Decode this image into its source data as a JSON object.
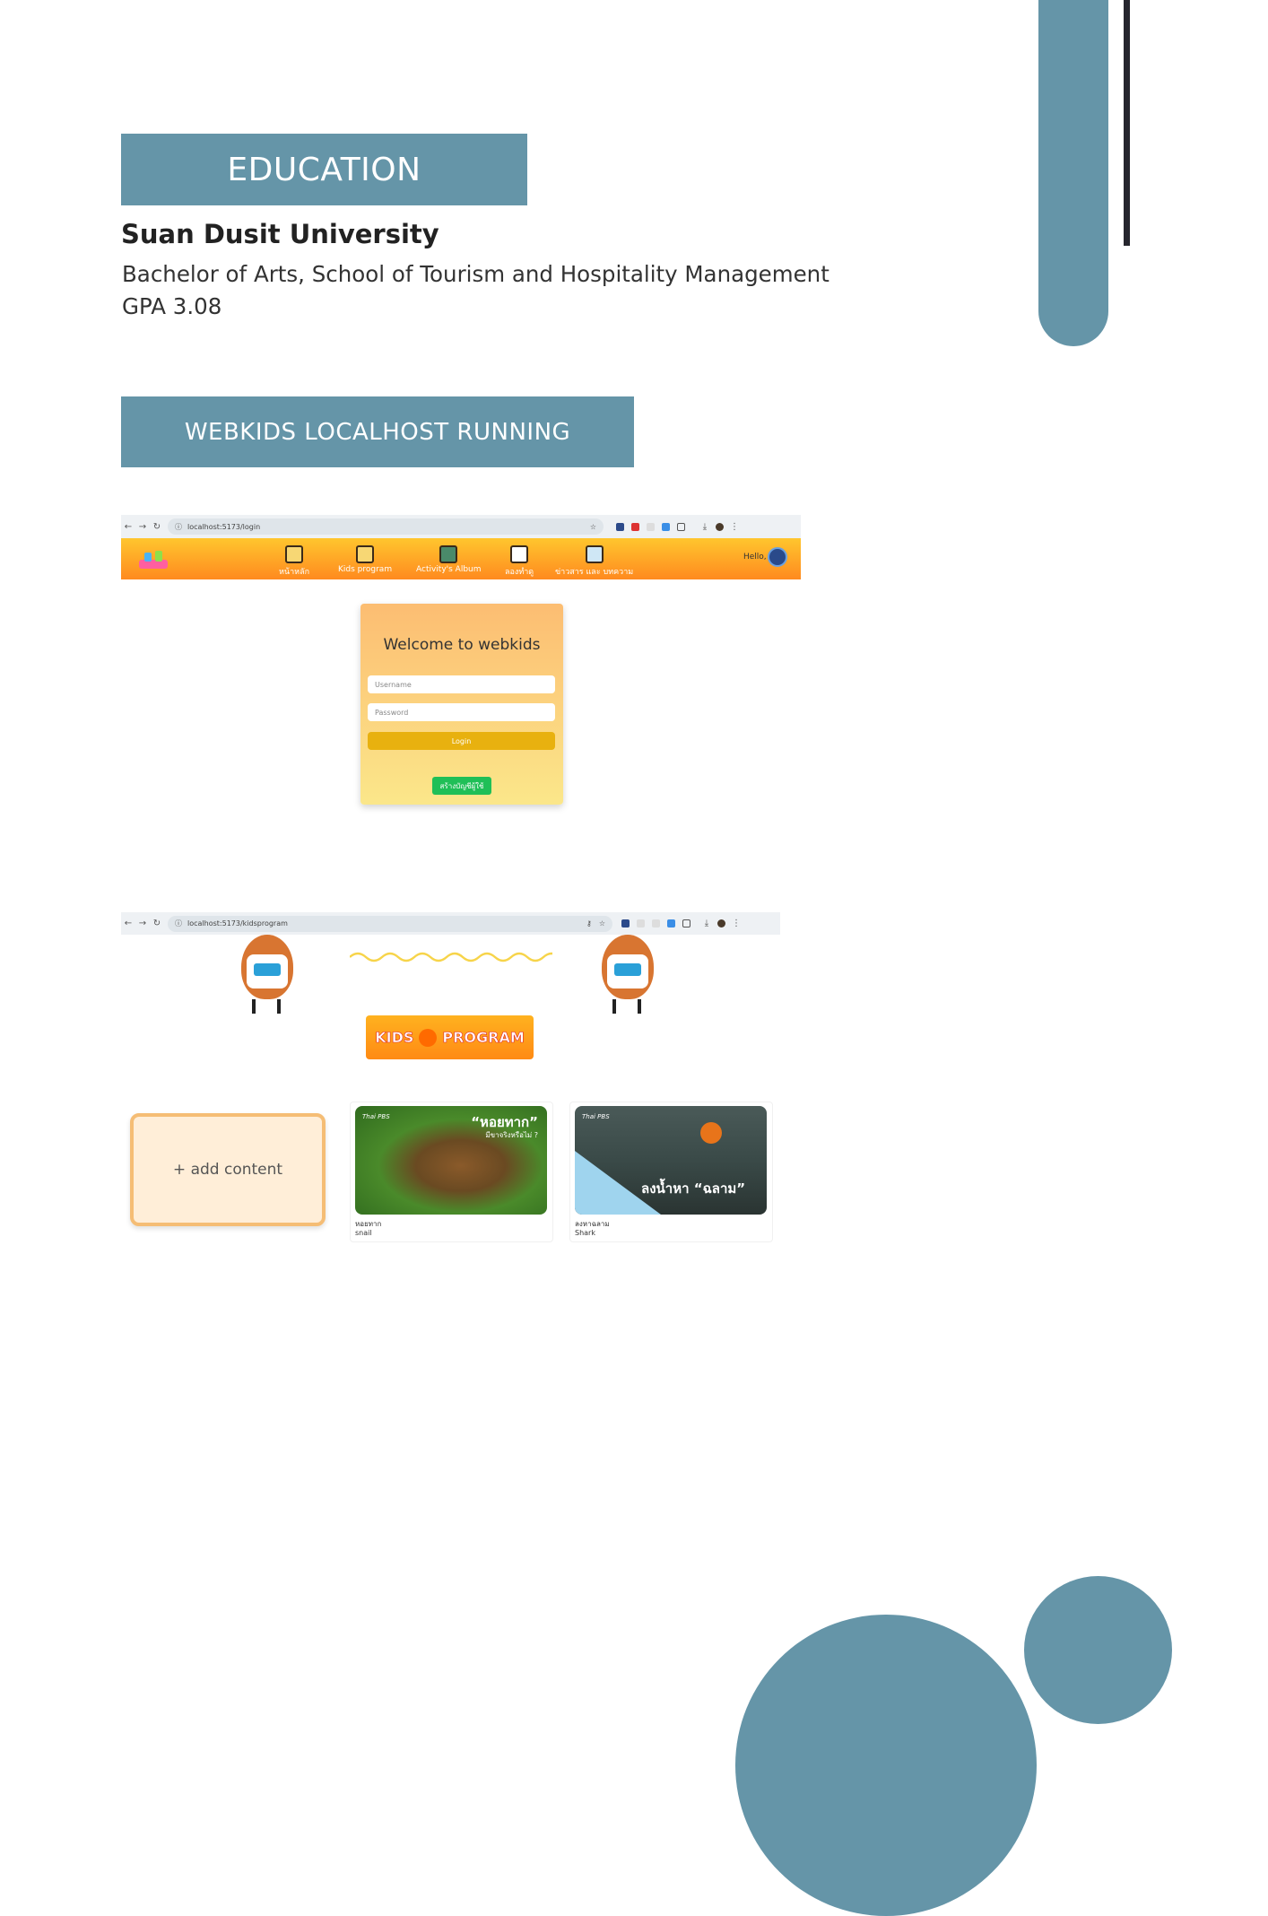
{
  "education": {
    "heading": "EDUCATION",
    "university": "Suan Dusit University",
    "degree": "Bachelor of Arts, School of Tourism and Hospitality Management",
    "gpa": "GPA 3.08"
  },
  "webkids": {
    "heading": "WEBKIDS LOCALHOST RUNNING"
  },
  "screenshot_login": {
    "url": "localhost:5173/login",
    "nav_items": [
      "หน้าหลัก",
      "Kids program",
      "Activity's Album",
      "ลองทำดู",
      "ข่าวสาร และ บทความ"
    ],
    "greeting": "Hello,",
    "welcome": "Welcome to webkids",
    "username_placeholder": "Username",
    "password_placeholder": "Password",
    "login_label": "Login",
    "create_account_label": "สร้างบัญชีผู้ใช้"
  },
  "screenshot_kids": {
    "url": "localhost:5173/kidsprogram",
    "banner_left": "KIDS",
    "banner_right": "PROGRAM",
    "add_content_label": "+ add content",
    "cards": [
      {
        "thumb_brand": "Thai PBS",
        "thumb_title": "“หอยทาก”",
        "thumb_sub": "มีขาจริงหรือไม่ ?",
        "name_th": "หอยทาก",
        "name_en": "snail"
      },
      {
        "thumb_brand": "Thai PBS",
        "thumb_title": "ลงน้ำหา “ฉลาม”",
        "thumb_sub": "",
        "name_th": "ลงหาฉลาม",
        "name_en": "Shark"
      }
    ]
  },
  "colors": {
    "accent": "#6595a8",
    "dark_line": "#26262e"
  }
}
